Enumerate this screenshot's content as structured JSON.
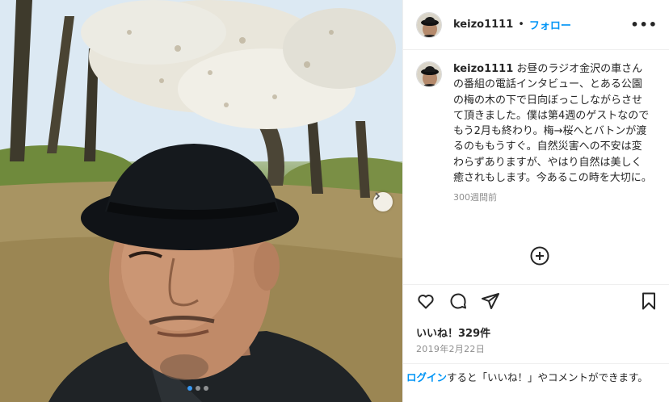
{
  "header": {
    "username": "keizo1111",
    "separator": "•",
    "follow_label": "フォロー",
    "more_icon": "•••"
  },
  "caption": {
    "username": "keizo1111",
    "text": "お昼のラジオ金沢の車さんの番組の電話インタビュー、とある公園の梅の木の下で日向ぼっこしながらさせて頂きました。僕は第4週のゲストなのでもう2月も終わり。梅→桜へとバトンが渡るのももうすぐ。自然災害への不安は変わらずありますが、やはり自然は美しく癒されもします。今あるこの時を大切に。",
    "time_ago": "300週間前"
  },
  "actions": {
    "icons": [
      "heart-icon",
      "comment-icon",
      "share-icon",
      "bookmark-icon"
    ]
  },
  "likes": "いいね！329件",
  "date": "2019年2月22日",
  "login_bar": {
    "link": "ログイン",
    "rest": "すると「いいね！」やコメントができます。"
  },
  "carousel": {
    "total": 3,
    "active_index": 0
  },
  "colors": {
    "accent": "#0095f6",
    "secondary_text": "#8e8e8e",
    "border": "#efefef"
  }
}
